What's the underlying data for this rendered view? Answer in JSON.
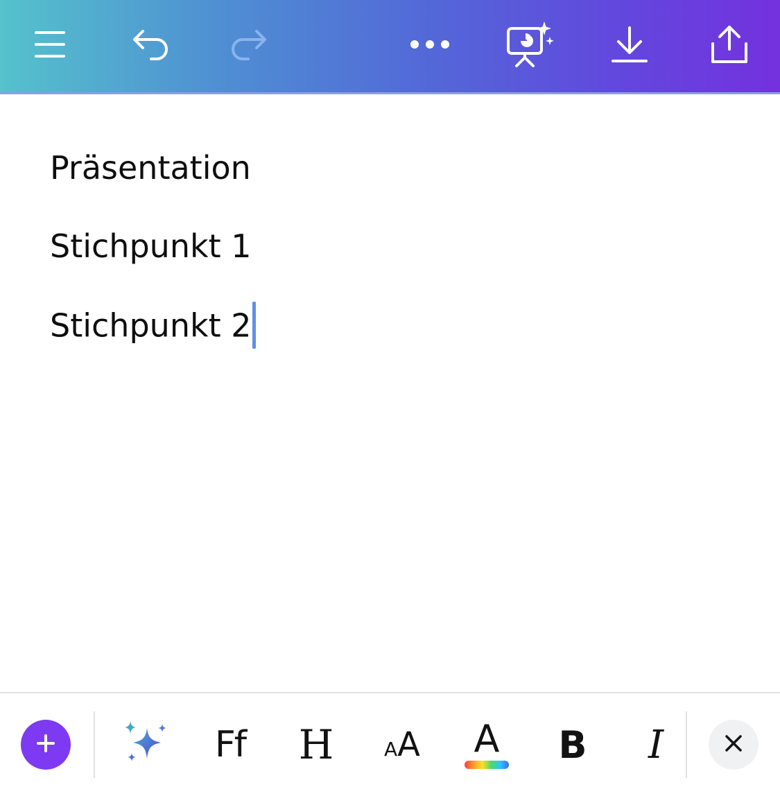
{
  "app": {
    "accent_color": "#7d3af2",
    "topbar_gradient": [
      "#55c2cc",
      "#5368d8",
      "#7431de"
    ],
    "caret_color": "#5f8fe8"
  },
  "toolbar": {
    "icons": [
      "menu-icon",
      "undo-icon",
      "redo-icon",
      "more-icon",
      "present-magic-icon",
      "download-icon",
      "share-icon"
    ]
  },
  "document": {
    "lines": [
      "Präsentation",
      "Stichpunkt 1",
      "Stichpunkt 2"
    ]
  },
  "format_toolbar": {
    "add_label": "+",
    "font_label": "Ff",
    "heading_label": "H",
    "size_small_label": "A",
    "size_large_label": "A",
    "color_label": "A",
    "bold_label": "B",
    "italic_label": "I",
    "icons": [
      "add-icon",
      "magic-sparkle-icon",
      "font-icon",
      "heading-icon",
      "text-size-icon",
      "text-color-icon",
      "bold-icon",
      "italic-icon",
      "close-icon"
    ]
  }
}
